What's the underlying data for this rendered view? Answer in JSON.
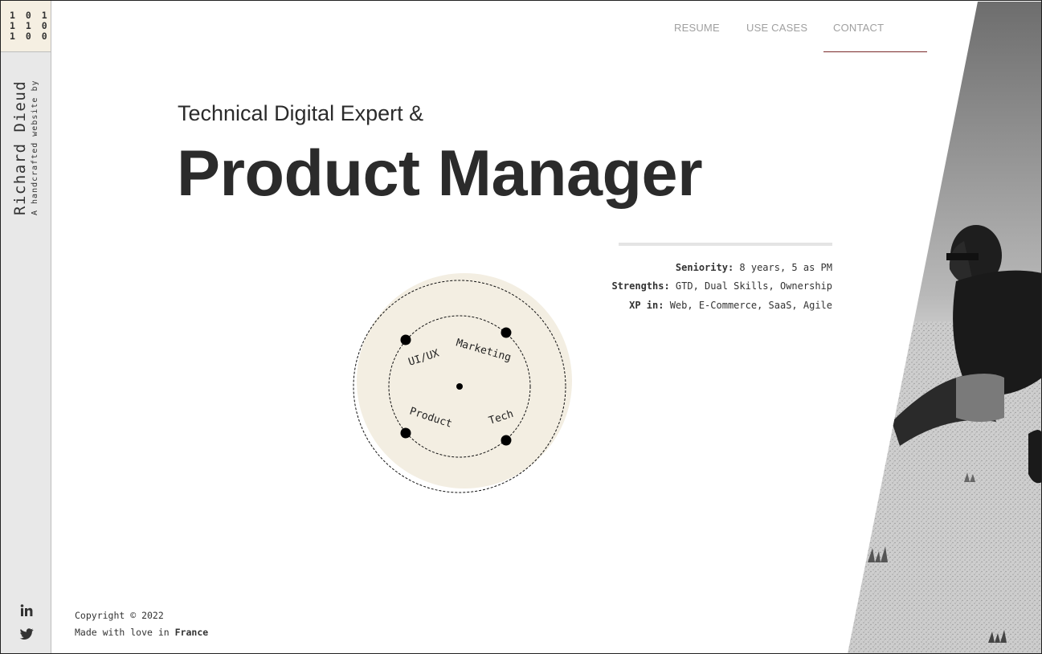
{
  "logo": {
    "rows": [
      "1 0 1",
      "1 1 0",
      "1 0 0"
    ]
  },
  "credit": {
    "prefix": "A handcrafted website by",
    "name": "Richard Dieud"
  },
  "nav": {
    "items": [
      "RESUME",
      "USE CASES",
      "CONTACT"
    ],
    "active": "CONTACT"
  },
  "hero": {
    "subtitle": "Technical Digital Expert &",
    "title": "Product Manager"
  },
  "skills": {
    "labels": [
      "UI/UX",
      "Marketing",
      "Product",
      "Tech"
    ]
  },
  "info": {
    "seniority_label": "Seniority:",
    "seniority_value": " 8 years, 5 as PM",
    "strengths_label": "Strengths:",
    "strengths_value": " GTD, Dual Skills, Ownership",
    "xp_label": "XP in:",
    "xp_value": " Web, E-Commerce, SaaS, Agile"
  },
  "footer": {
    "copyright": "Copyright © 2022",
    "made_prefix": "Made with love in ",
    "made_country": "France"
  },
  "social": {
    "icons": [
      "linkedin-icon",
      "twitter-icon"
    ]
  },
  "colors": {
    "accent": "#7a2b2b",
    "beige": "#f3eee2",
    "sidebar": "#e8e8e8",
    "text": "#2b2b2b",
    "nav": "#a0a0a0"
  }
}
